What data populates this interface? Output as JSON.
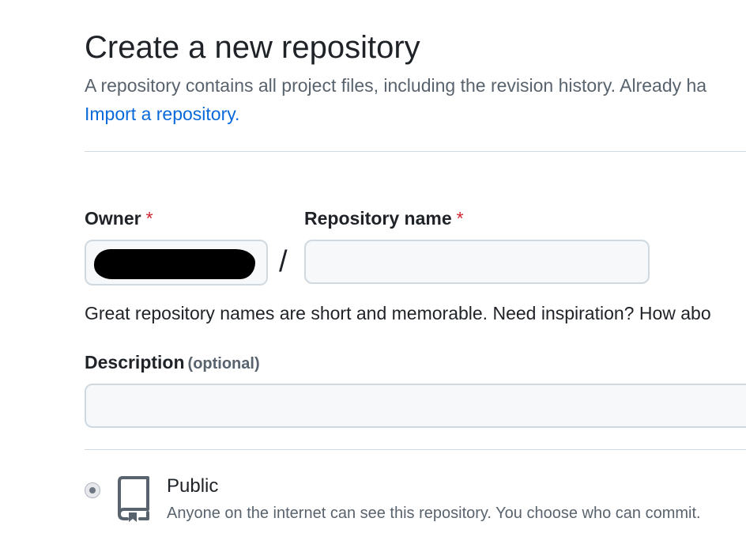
{
  "header": {
    "title": "Create a new repository",
    "subtitle": "A repository contains all project files, including the revision history. Already ha",
    "import_link": "Import a repository."
  },
  "owner": {
    "label": "Owner",
    "required_mark": "*",
    "value": ""
  },
  "separator": "/",
  "repository_name": {
    "label": "Repository name",
    "required_mark": "*",
    "value": "",
    "hint": "Great repository names are short and memorable. Need inspiration? How abo"
  },
  "description": {
    "label": "Description",
    "optional_label": "(optional)",
    "value": ""
  },
  "visibility": {
    "option_public": {
      "title": "Public",
      "description": "Anyone on the internet can see this repository. You choose who can commit.",
      "selected": true,
      "icon": "repo-icon"
    }
  },
  "colors": {
    "link": "#0969da",
    "required": "#d1242f",
    "muted_text": "#59636e",
    "border": "#d1d9e0",
    "input_bg": "#f6f8fa"
  }
}
